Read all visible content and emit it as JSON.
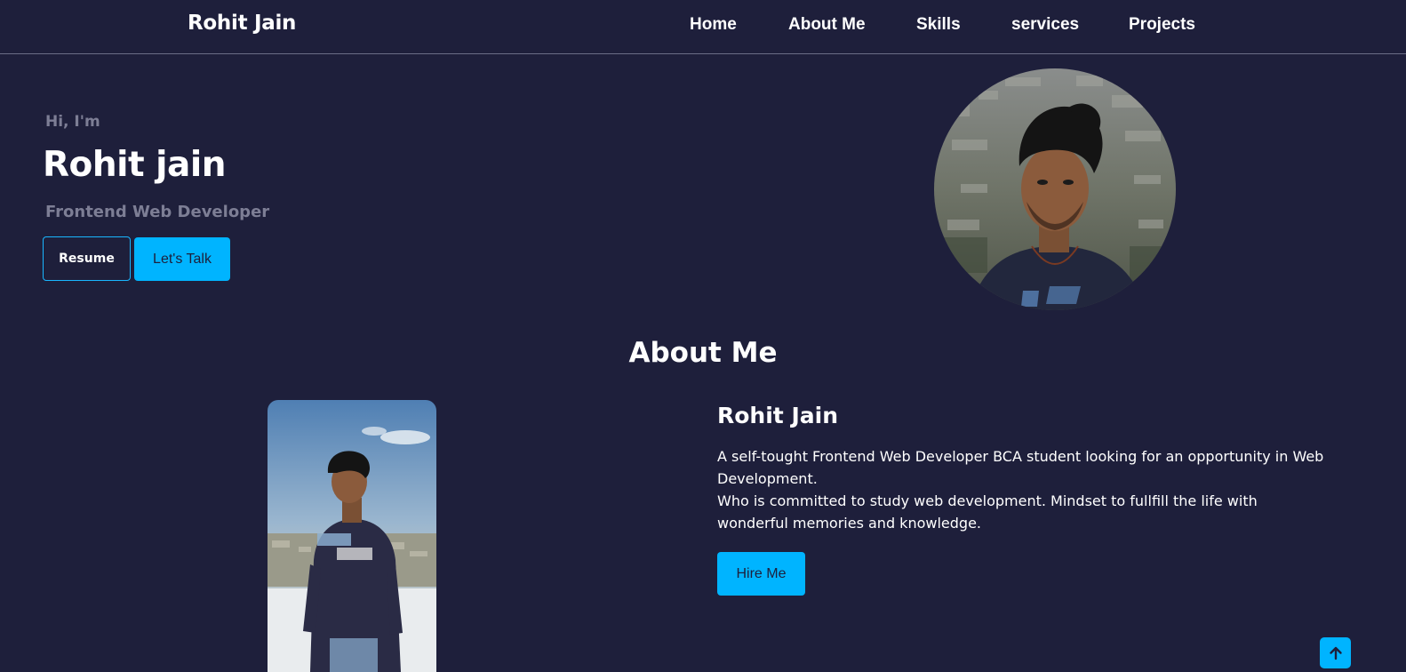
{
  "header": {
    "brand": "Rohit Jain",
    "nav": [
      "Home",
      "About Me",
      "Skills",
      "services",
      "Projects"
    ]
  },
  "hero": {
    "greeting": "Hi, I'm",
    "name": "Rohit jain",
    "role": "Frontend Web Developer",
    "resume_label": "Resume",
    "talk_label": "Let's Talk"
  },
  "about": {
    "title": "About Me",
    "name": "Rohit Jain",
    "para1": "A self-tought Frontend Web Developer BCA student looking for an opportunity in Web Development.",
    "para2": "Who is committed to study web development. Mindset to fullfill the life with wonderful memories and knowledge.",
    "hire_label": "Hire Me"
  },
  "colors": {
    "background": "#1e1f3b",
    "accent": "#00b4ff",
    "muted": "#7d7e95"
  },
  "icons": {
    "scroll_top": "arrow-up-icon"
  }
}
